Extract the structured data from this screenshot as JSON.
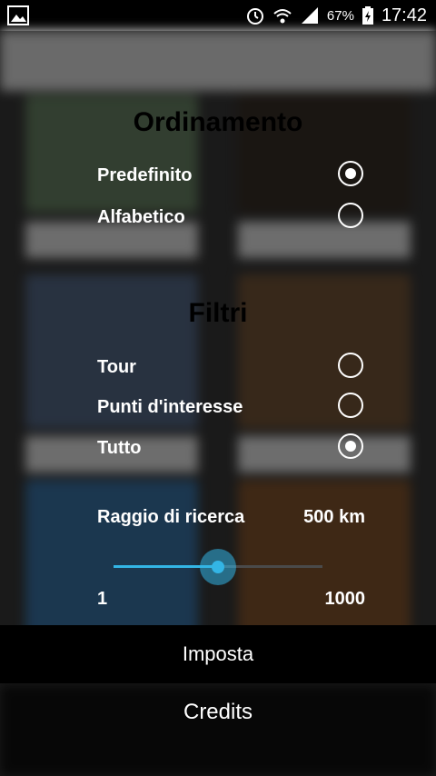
{
  "status_bar": {
    "battery_percent": "67%",
    "time": "17:42",
    "icons": [
      "image-icon",
      "alarm-icon",
      "wifi-icon",
      "signal-icon",
      "battery-charging-icon"
    ]
  },
  "sort": {
    "title": "Ordinamento",
    "options": [
      {
        "label": "Predefinito",
        "selected": true
      },
      {
        "label": "Alfabetico",
        "selected": false
      }
    ]
  },
  "filters": {
    "title": "Filtri",
    "options": [
      {
        "label": "Tour",
        "selected": false
      },
      {
        "label": "Punti d'interesse",
        "selected": false
      },
      {
        "label": "Tutto",
        "selected": true
      }
    ]
  },
  "search_radius": {
    "label": "Raggio di ricerca",
    "value_text": "500 km",
    "value": 500,
    "min_label": "1",
    "max_label": "1000",
    "min": 1,
    "max": 1000
  },
  "actions": {
    "apply_label": "Imposta",
    "credits_label": "Credits"
  },
  "colors": {
    "accent": "#33b5e5",
    "overlay": "#000000",
    "text": "#ffffff"
  }
}
